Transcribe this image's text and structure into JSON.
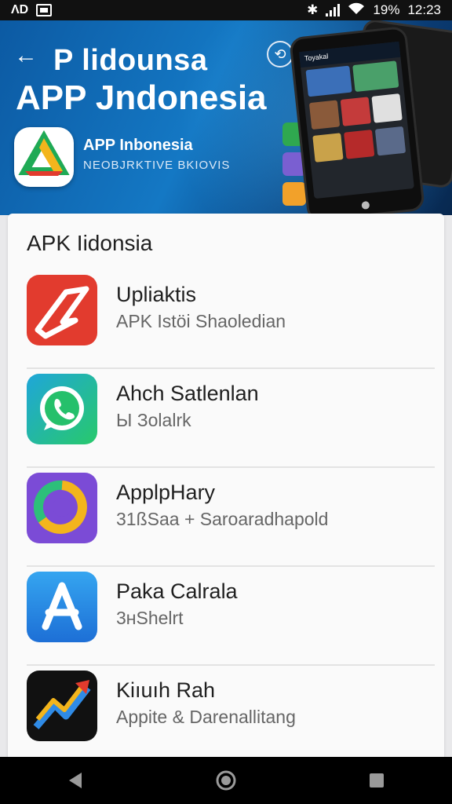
{
  "status_bar": {
    "left_glyph": "ΛD",
    "battery": "19%",
    "time": "12:23"
  },
  "hero": {
    "back_icon": "arrow-left-icon",
    "title_line1": "P lidounsa",
    "title_line2": "APP Jndonesia",
    "subtitle": "APP Inbonesia",
    "tagline": "NEOBJRKTIVE BKIOVIS",
    "phone_brand": "Toyakal"
  },
  "section": {
    "title": "APK Iidonsia"
  },
  "apps": [
    {
      "name": "Upliaktis",
      "desc": "APK Istöi Shaoledian",
      "icon": "red-app-icon",
      "color": "#e23b2e"
    },
    {
      "name": "Ahch Satlenlan",
      "desc": "Ы Зolalrk",
      "icon": "whatsapp-icon",
      "color": "#25c06b"
    },
    {
      "name": "ApplpHary",
      "desc": "31ßSaa + Saroaradhapold",
      "icon": "purple-app-icon",
      "color": "#7b4bd6"
    },
    {
      "name": "Paka Calrala",
      "desc": "3ʜShelrt",
      "icon": "app-store-icon",
      "color": "#2f8be6"
    },
    {
      "name": "Kiıuıh Rah",
      "desc": "Appite & Darenallitang",
      "icon": "chart-arrow-icon",
      "color": "#111111"
    }
  ],
  "nav": {
    "back": "back-triangle-icon",
    "home": "home-circle-icon",
    "recents": "recents-square-icon"
  }
}
